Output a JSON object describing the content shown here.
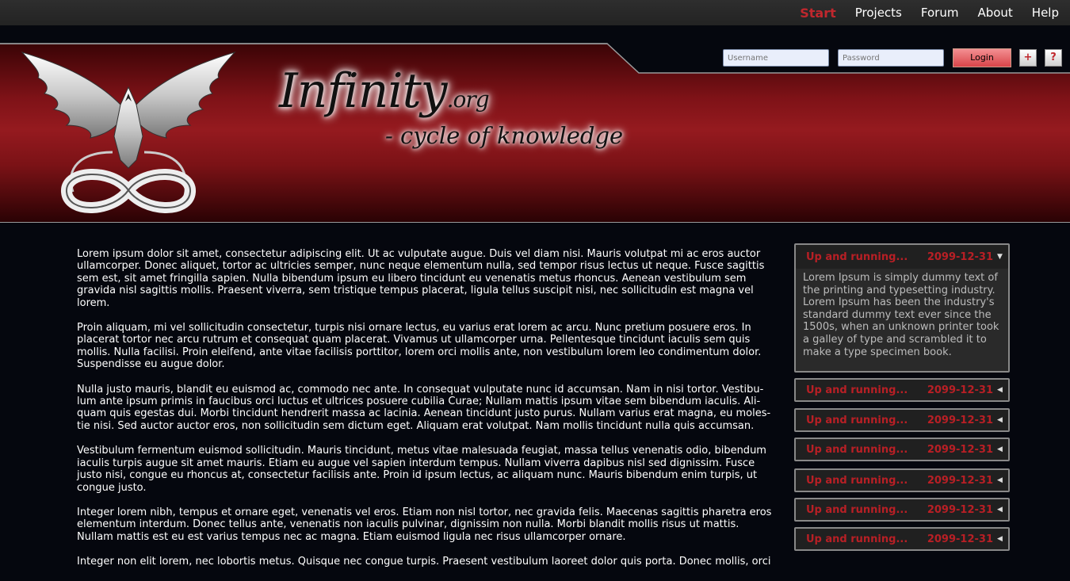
{
  "nav": {
    "items": [
      {
        "label": "Start"
      },
      {
        "label": "Projects"
      },
      {
        "label": "Forum"
      },
      {
        "label": "About"
      },
      {
        "label": "Help"
      }
    ]
  },
  "header": {
    "title": "Infinity",
    "title_suffix": ".org",
    "tagline": "- cycle of knowledge"
  },
  "login": {
    "username_placeholder": "Username",
    "password_placeholder": "Password",
    "login_label": "Login",
    "register_label": "+",
    "help_label": "?"
  },
  "content": {
    "paragraphs": [
      " Lorem ipsum dolor sit amet, consectetur adipiscing elit. Ut ac vulputate augue. Duis vel diam nisi. Mauris volutpat mi ac eros auctor ullamcorper. Donec aliquet, tortor ac ultricies semper, nunc neque elementum nulla, sed tempor risus lectus ut neque. Fusce sagittis sem est, sit amet fringilla sapien. Nulla bibendum ipsum eu libero tincidunt eu venenatis metus rhoncus. Aenean vestibulum sem gravida nisl sagittis mollis. Praesent viverra, sem tristique tempus placerat, ligula tellus suscipit nisi, nec sollicitudin est magna vel lorem.",
      "Proin aliquam, mi vel sollicitudin consectetur, turpis nisi ornare lectus, eu varius erat lorem ac arcu. Nunc pretium posuere eros. In placerat tortor nec arcu rutrum et consequat quam placerat. Vivamus ut ullamcorper urna. Pellentesque tincidunt iaculis sem quis mollis. Nulla facilisi. Proin eleifend, ante vitae facilisis porttitor, lorem orci mollis ante, non vestibulum lorem leo condimentum dolor. Suspendisse eu augue dolor.",
      "Nulla justo mauris, blandit eu euismod ac, commodo nec ante. In consequat vulputate nunc id accumsan. Nam in nisi tortor. Vestibu-lum ante ipsum primis in faucibus orci luctus et ultrices posuere cubilia Curae; Nullam mattis ipsum vitae sem bibendum iaculis. Ali-quam quis egestas dui. Morbi tincidunt hendrerit massa ac lacinia. Aenean tincidunt justo purus. Nullam varius erat magna, eu moles-tie nisi. Sed auctor auctor eros, non sollicitudin sem dictum eget. Aliquam erat volutpat. Nam mollis tincidunt nulla quis accumsan.",
      "Vestibulum fermentum euismod sollicitudin. Mauris tincidunt, metus vitae malesuada feugiat, massa tellus venenatis odio, bibendum iaculis turpis augue sit amet mauris. Etiam eu augue vel sapien interdum tempus. Nullam viverra dapibus nisl sed dignissim. Fusce justo nisi, congue eu rhoncus at, consectetur facilisis ante. Proin id ipsum lectus, ac aliquam nunc. Mauris bibendum enim turpis, ut congue justo.",
      "Integer lorem nibh, tempus et ornare eget, venenatis vel eros. Etiam non nisl tortor, nec gravida felis. Maecenas sagittis pharetra eros elementum interdum. Donec tellus ante, venenatis non iaculis pulvinar, dignissim non nulla. Morbi blandit mollis risus ut mattis. Nullam mattis est eu est varius tempus nec ac magna. Etiam euismod ligula nec risus ullamcorper ornare.",
      "Integer non elit lorem, nec lobortis metus. Quisque nec congue turpis. Praesent vestibulum laoreet dolor quis porta. Donec mollis, orci"
    ]
  },
  "news": [
    {
      "title": "Up and running...",
      "date": "2099-12-31",
      "open": true,
      "body": "Lorem Ipsum is simply dummy text of the printing and typesetting industry. Lorem Ipsum has been the industry's standard dummy text ever since the 1500s, when an unknown printer took a galley of type and scrambled it to make a type specimen book."
    },
    {
      "title": "Up and running...",
      "date": "2099-12-31",
      "open": false
    },
    {
      "title": "Up and running...",
      "date": "2099-12-31",
      "open": false
    },
    {
      "title": "Up and running...",
      "date": "2099-12-31",
      "open": false
    },
    {
      "title": "Up and running...",
      "date": "2099-12-31",
      "open": false
    },
    {
      "title": "Up and running...",
      "date": "2099-12-31",
      "open": false
    },
    {
      "title": "Up and running...",
      "date": "2099-12-31",
      "open": false
    }
  ],
  "colors": {
    "accent": "#c0272d",
    "header_red": "#951a1f",
    "background": "#05070e"
  }
}
